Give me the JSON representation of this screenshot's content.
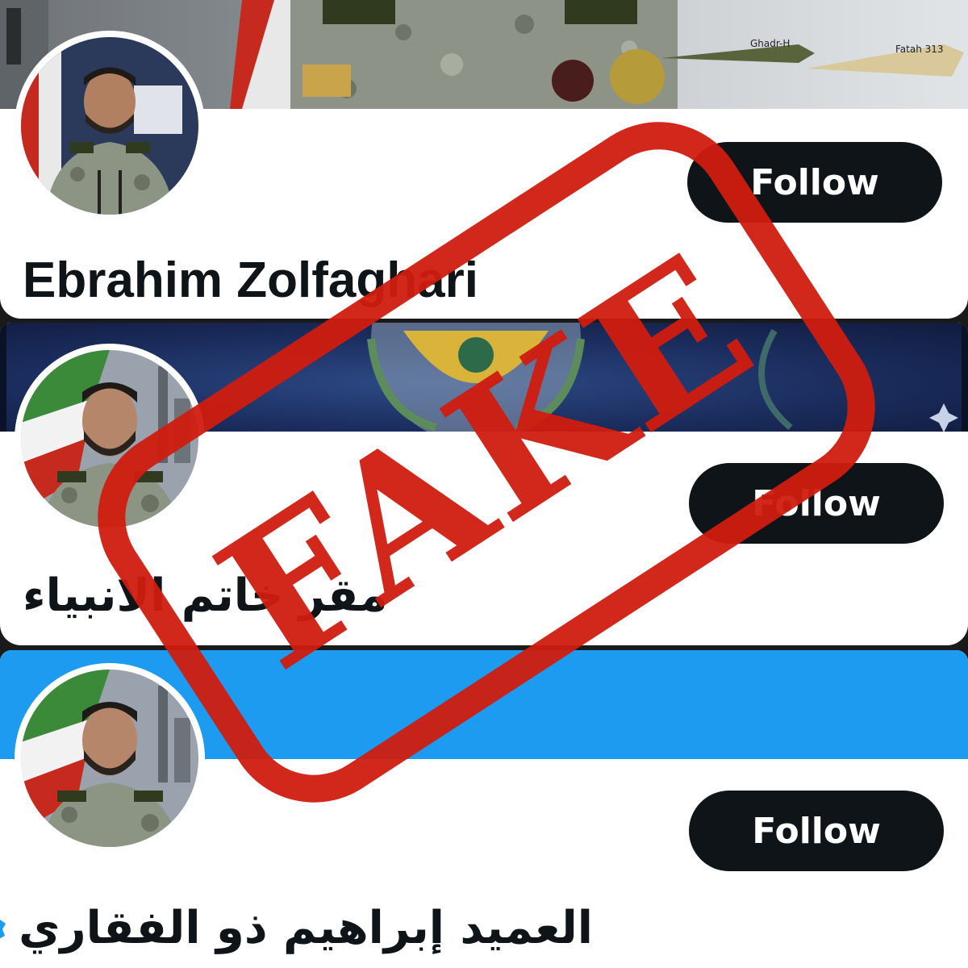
{
  "profiles": [
    {
      "name": "Ebrahim Zolfaghari",
      "follow_label": "Follow",
      "banner_labels": [
        "Ghadr-H",
        "Fatah 313"
      ]
    },
    {
      "name": "مقر خاتم الانبياء",
      "follow_label": "Follow"
    },
    {
      "name": "العميد إبراهيم ذو الفقاري",
      "follow_label": "Follow",
      "verified": true
    }
  ],
  "stamp": {
    "text": "FAKE"
  },
  "colors": {
    "follow_bg": "#0f1419",
    "stamp_red": "#d01c0f",
    "banner_blue": "#1d9bf0",
    "verified_blue": "#1d9bf0"
  }
}
